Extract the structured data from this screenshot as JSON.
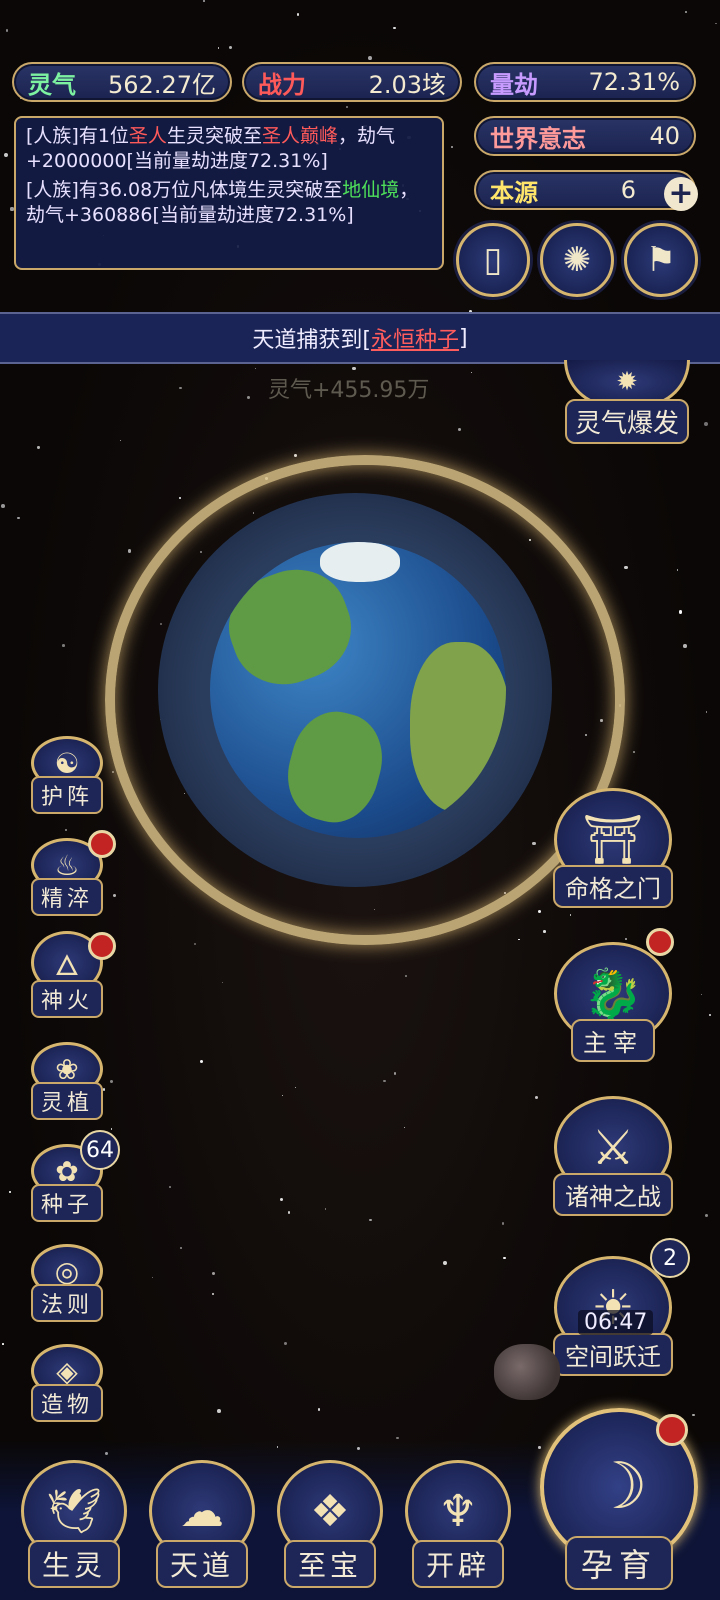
{
  "stats": {
    "lingqi": {
      "label": "灵气",
      "value": "562.27亿",
      "color": "#7df2a0"
    },
    "zhanli": {
      "label": "战力",
      "value": "2.03垓",
      "color": "#ff5a5a"
    },
    "liangjie": {
      "label": "量劫",
      "value": "72.31%",
      "color": "#c79bff"
    },
    "shijie": {
      "label": "世界意志",
      "value": "40",
      "color": "#ff9a9a"
    },
    "benyuan": {
      "label": "本源",
      "value": "6",
      "color": "#ffe66b"
    }
  },
  "log": {
    "line1_a": "[人族]有1位",
    "line1_b": "圣人",
    "line1_c": "生灵突破至",
    "line1_d": "圣人巅峰",
    "line1_e": "，劫气+2000000[当前量劫进度72.31%]",
    "line2_a": "[人族]有36.08万位凡体境生灵突破至",
    "line2_b": "地仙境",
    "line2_c": "，劫气+360886[当前量劫进度72.31%]"
  },
  "banner": {
    "prefix": "天道捕获到[",
    "item": "永恒种子",
    "suffix": "]"
  },
  "floating_gain": "灵气+455.95万",
  "burst_button": "灵气爆发",
  "left_buttons": [
    {
      "label": "护阵"
    },
    {
      "label": "精淬"
    },
    {
      "label": "神火"
    },
    {
      "label": "灵植"
    },
    {
      "label": "种子",
      "count": "64"
    },
    {
      "label": "法则"
    },
    {
      "label": "造物"
    }
  ],
  "right_buttons": [
    {
      "label": "命格之门"
    },
    {
      "label": "主宰"
    },
    {
      "label": "诸神之战"
    },
    {
      "label": "空间跃迁",
      "count": "2",
      "timer": "06:47"
    }
  ],
  "bottom_buttons": [
    {
      "label": "生灵"
    },
    {
      "label": "天道"
    },
    {
      "label": "至宝"
    },
    {
      "label": "开辟"
    }
  ],
  "main_button": {
    "label": "孕育"
  }
}
